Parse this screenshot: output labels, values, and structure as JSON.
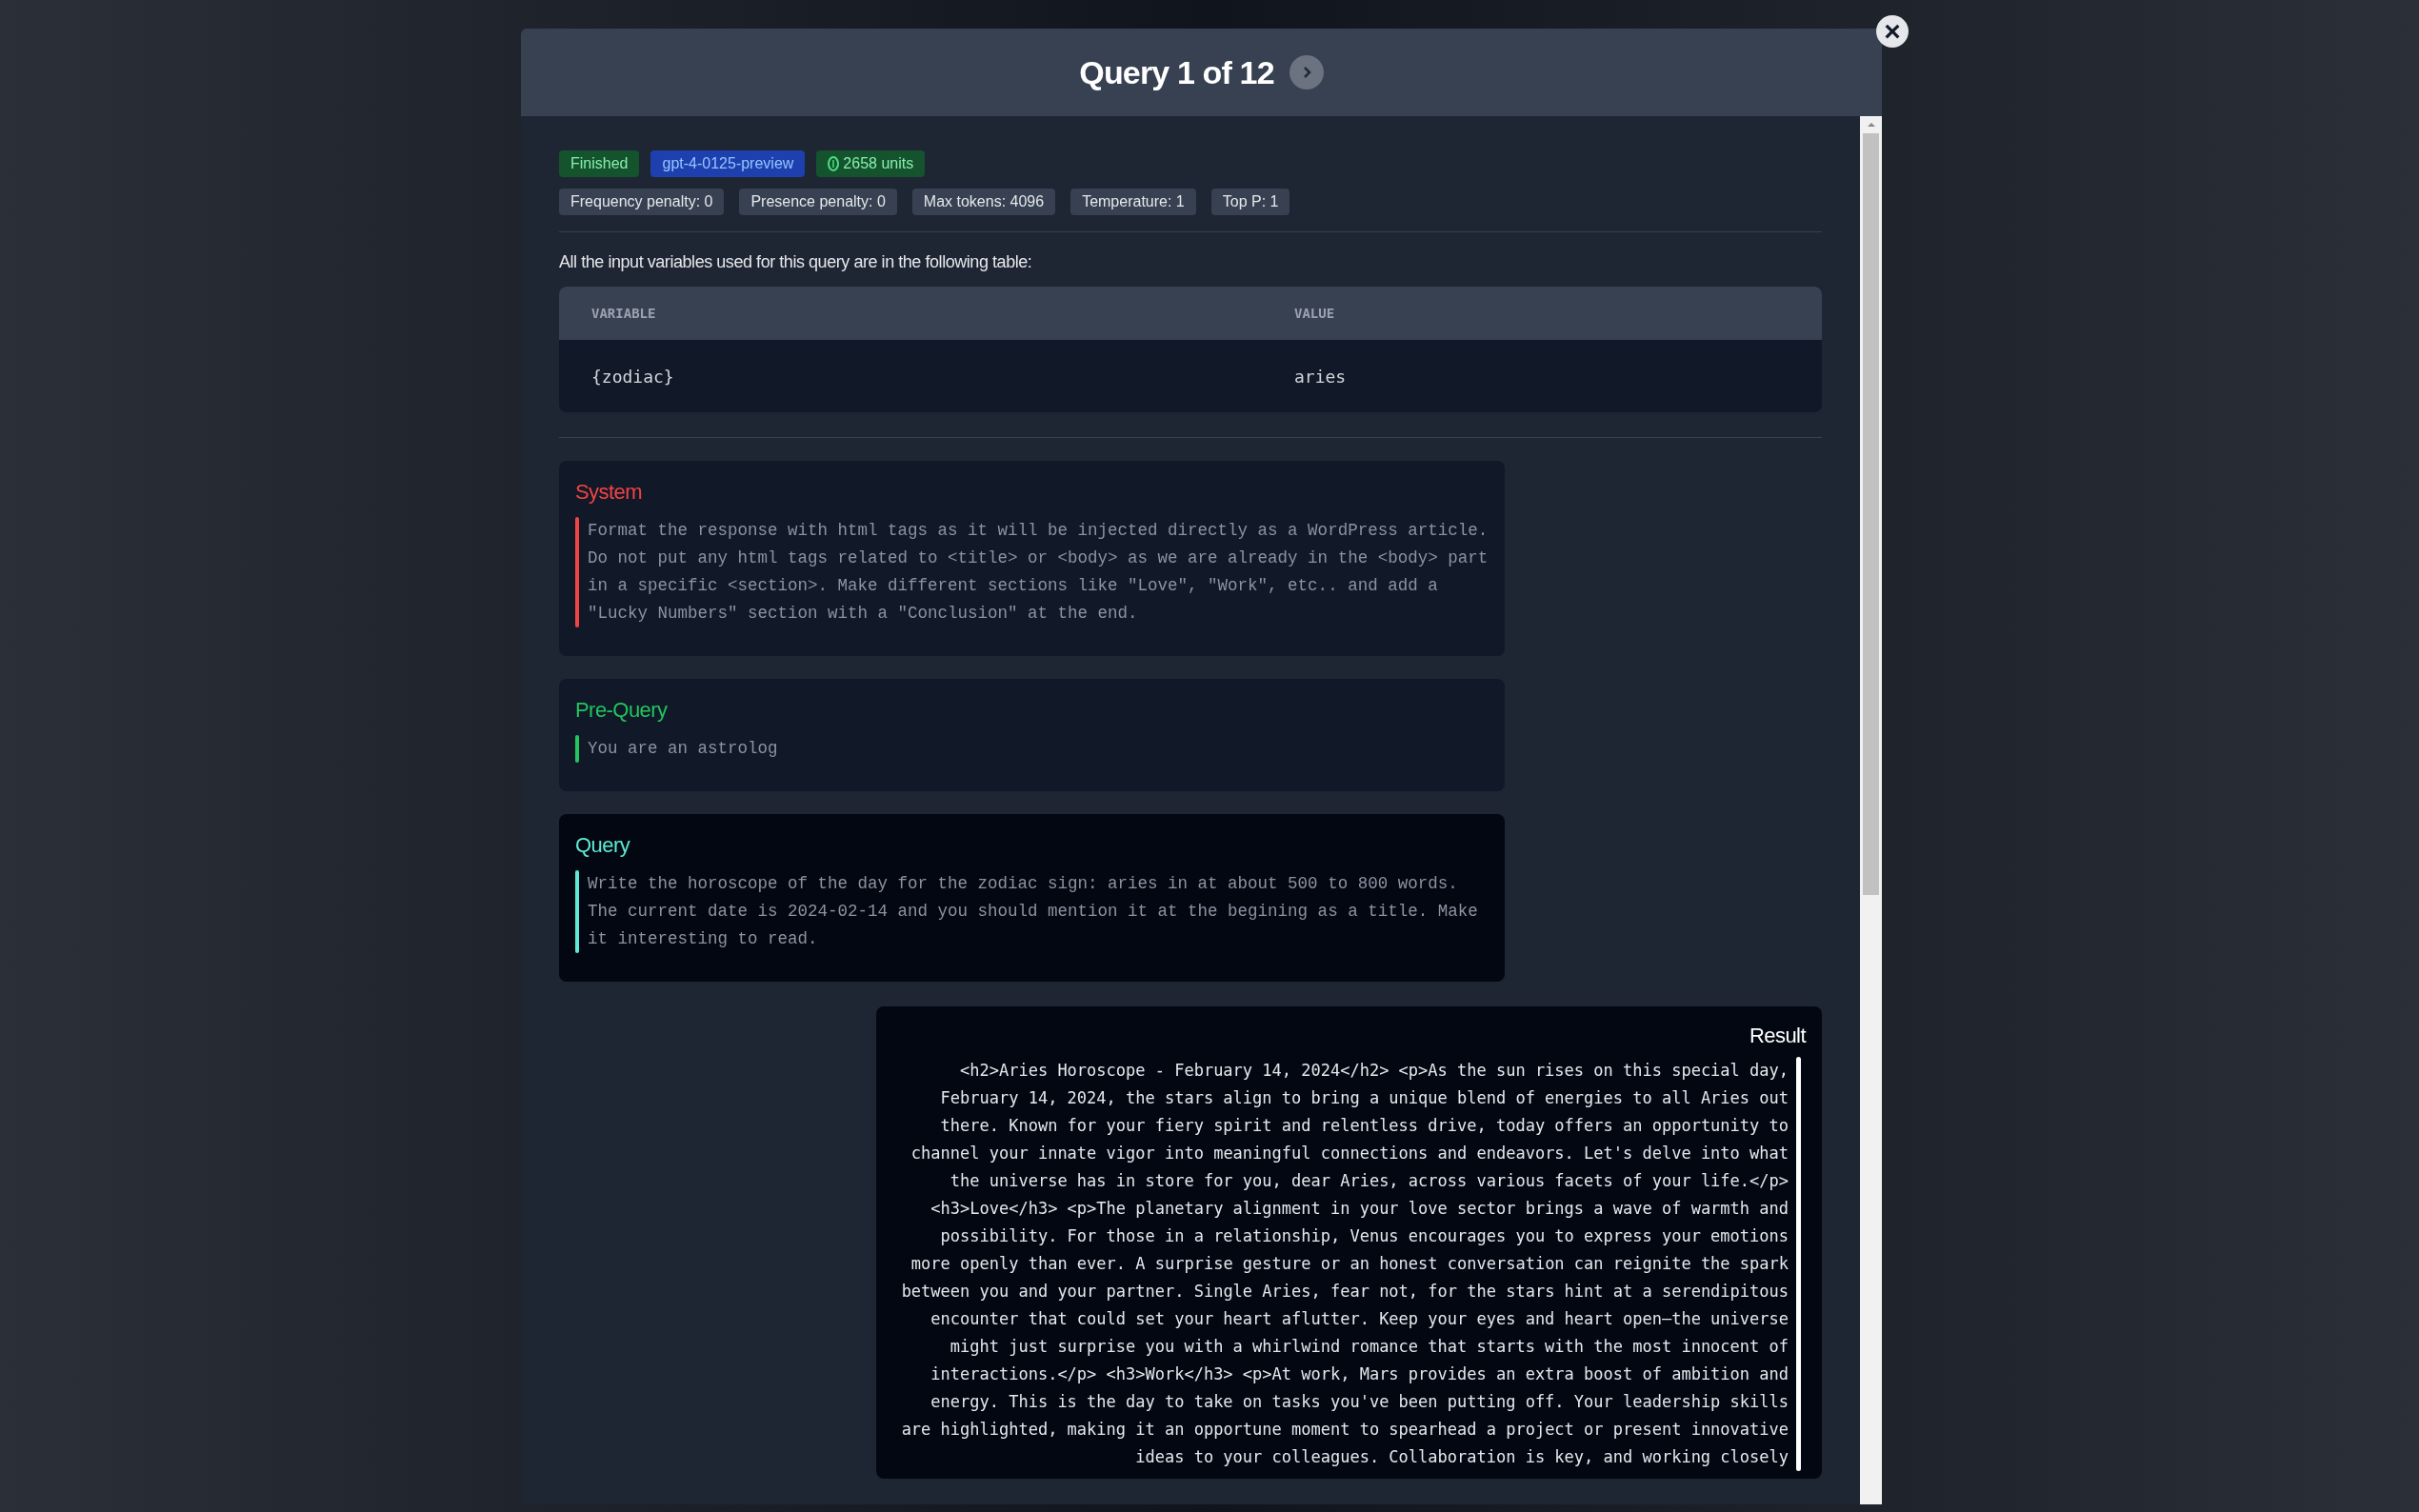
{
  "modal": {
    "title": "Query 1 of 12",
    "close_label": "×",
    "badges": [
      {
        "kind": "status",
        "text": "Finished"
      },
      {
        "kind": "model",
        "text": "gpt-4-0125-preview"
      },
      {
        "kind": "units",
        "text": "2658 units"
      }
    ],
    "parameters": [
      "Frequency penalty: 0",
      "Presence penalty: 0",
      "Max tokens: 4096",
      "Temperature: 1",
      "Top P: 1"
    ],
    "intro": "All the input variables used for this query are in the following table:",
    "table": {
      "columns": [
        "VARIABLE",
        "VALUE"
      ],
      "rows": [
        [
          "{zodiac}",
          "aries"
        ]
      ]
    },
    "prompts": [
      {
        "kind": "system",
        "title": "System",
        "color": "#ef4444",
        "text": "Format the response with html tags as it will be injected directly as a WordPress article. Do not put any html tags related to <title> or <body> as we are already in the <body> part in a specific <section>. Make different sections like \"Love\", \"Work\", etc.. and add a \"Lucky Numbers\" section with a \"Conclusion\" at the end."
      },
      {
        "kind": "pre_query",
        "title": "Pre-Query",
        "color": "#22c55e",
        "text": "You are an astrolog"
      },
      {
        "kind": "query",
        "title": "Query",
        "color": "#5eead4",
        "text": "Write the horoscope of the day for the zodiac sign: aries in at about 500 to 800 words. The current date is 2024-02-14 and you should mention it at the begining as a title. Make it interesting to read."
      }
    ],
    "result": {
      "title": "Result",
      "text": "<h2>Aries Horoscope - February 14, 2024</h2> <p>As the sun rises on this special day, February 14, 2024, the stars align to bring a unique blend of energies to all Aries out there. Known for your fiery spirit and relentless drive, today offers an opportunity to channel your innate vigor into meaningful connections and endeavors. Let's delve into what the universe has in store for you, dear Aries, across various facets of your life.</p> <h3>Love</h3> <p>The planetary alignment in your love sector brings a wave of warmth and possibility. For those in a relationship, Venus encourages you to express your emotions more openly than ever. A surprise gesture or an honest conversation can reignite the spark between you and your partner. Single Aries, fear not, for the stars hint at a serendipitous encounter that could set your heart aflutter. Keep your eyes and heart open—the universe might just surprise you with a whirlwind romance that starts with the most innocent of interactions.</p> <h3>Work</h3> <p>At work, Mars provides an extra boost of ambition and energy. This is the day to take on tasks you've been putting off. Your leadership skills are highlighted, making it an opportune moment to spearhead a project or present innovative ideas to your colleagues. Collaboration is key, and working closely"
    }
  }
}
